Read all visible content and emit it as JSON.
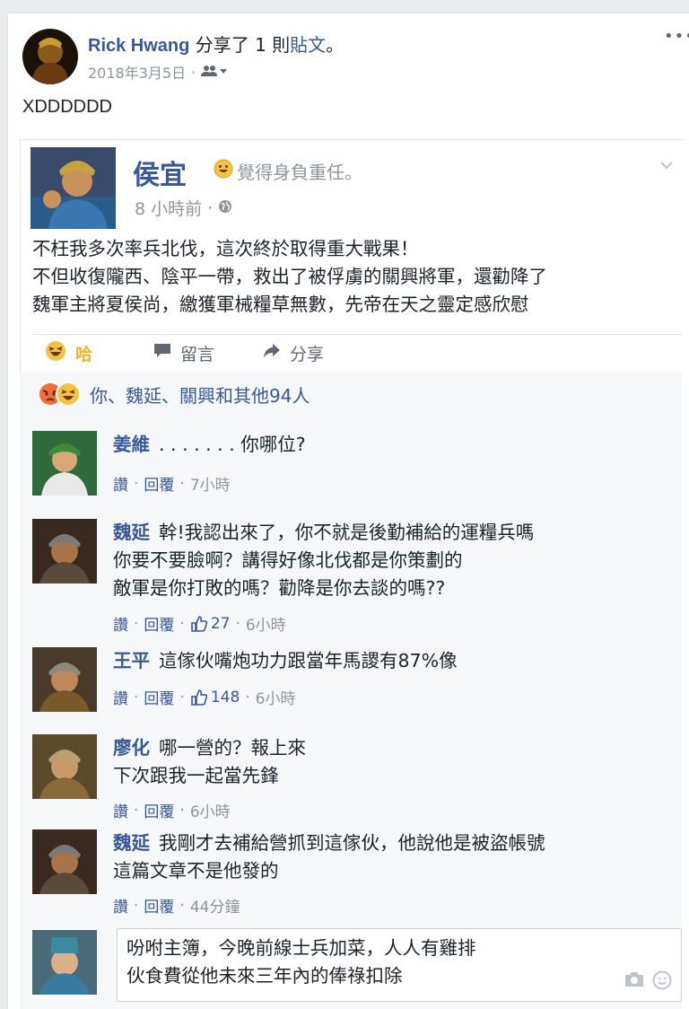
{
  "share_post": {
    "sharer_name": "Rick Hwang",
    "shared_text": "分享了",
    "shared_count": "1 則",
    "shared_object": "貼文",
    "shared_suffix": "。",
    "date": "2018年3月5日",
    "dot": "·",
    "post_text": "XDDDDDD"
  },
  "original_post": {
    "author": "侯宜",
    "feeling": "覺得身負重任。",
    "time": "8 小時前",
    "dot": "·",
    "lines": [
      "不枉我多次率兵北伐，這次終於取得重大戰果！",
      "不但收復隴西、陰平一帶，救出了被俘虜的關興將軍，還勸降了",
      "魏軍主將夏侯尚，繳獲軍械糧草無數，先帝在天之靈定感欣慰"
    ]
  },
  "actions": {
    "haha": "哈",
    "comment": "留言",
    "share": "分享"
  },
  "reactions": {
    "summary": "你、魏延、關興和其他94人"
  },
  "comment_labels": {
    "like": "讚",
    "reply": "回覆",
    "sep": "·"
  },
  "comments": [
    {
      "name": "姜維",
      "lines": [
        ". . . . . . . 你哪位?"
      ],
      "likes": "",
      "time": "7小時"
    },
    {
      "name": "魏延",
      "lines": [
        "幹!我認出來了，你不就是後勤補給的運糧兵嗎",
        "你要不要臉啊？講得好像北伐都是你策劃的",
        "敵軍是你打敗的嗎？勸降是你去談的嗎??"
      ],
      "likes": "27",
      "time": "6小時"
    },
    {
      "name": "王平",
      "lines": [
        "這傢伙嘴炮功力跟當年馬謖有87%像"
      ],
      "likes": "148",
      "time": "6小時"
    },
    {
      "name": "廖化",
      "lines": [
        "哪一營的？報上來",
        "下次跟我一起當先鋒"
      ],
      "likes": "",
      "time": "6小時"
    },
    {
      "name": "魏延",
      "lines": [
        "我剛才去補給營抓到這傢伙，他說他是被盜帳號",
        "這篇文章不是他發的"
      ],
      "likes": "",
      "time": "44分鐘"
    }
  ],
  "compose": {
    "lines": [
      "吩咐主簿，今晚前線士兵加菜，人人有雞排",
      "伙食費從他未來三年內的俸祿扣除"
    ]
  },
  "colors": {
    "link": "#385898",
    "meta": "#90949c",
    "haha": "#f7b125",
    "background": "#e9ebee"
  }
}
